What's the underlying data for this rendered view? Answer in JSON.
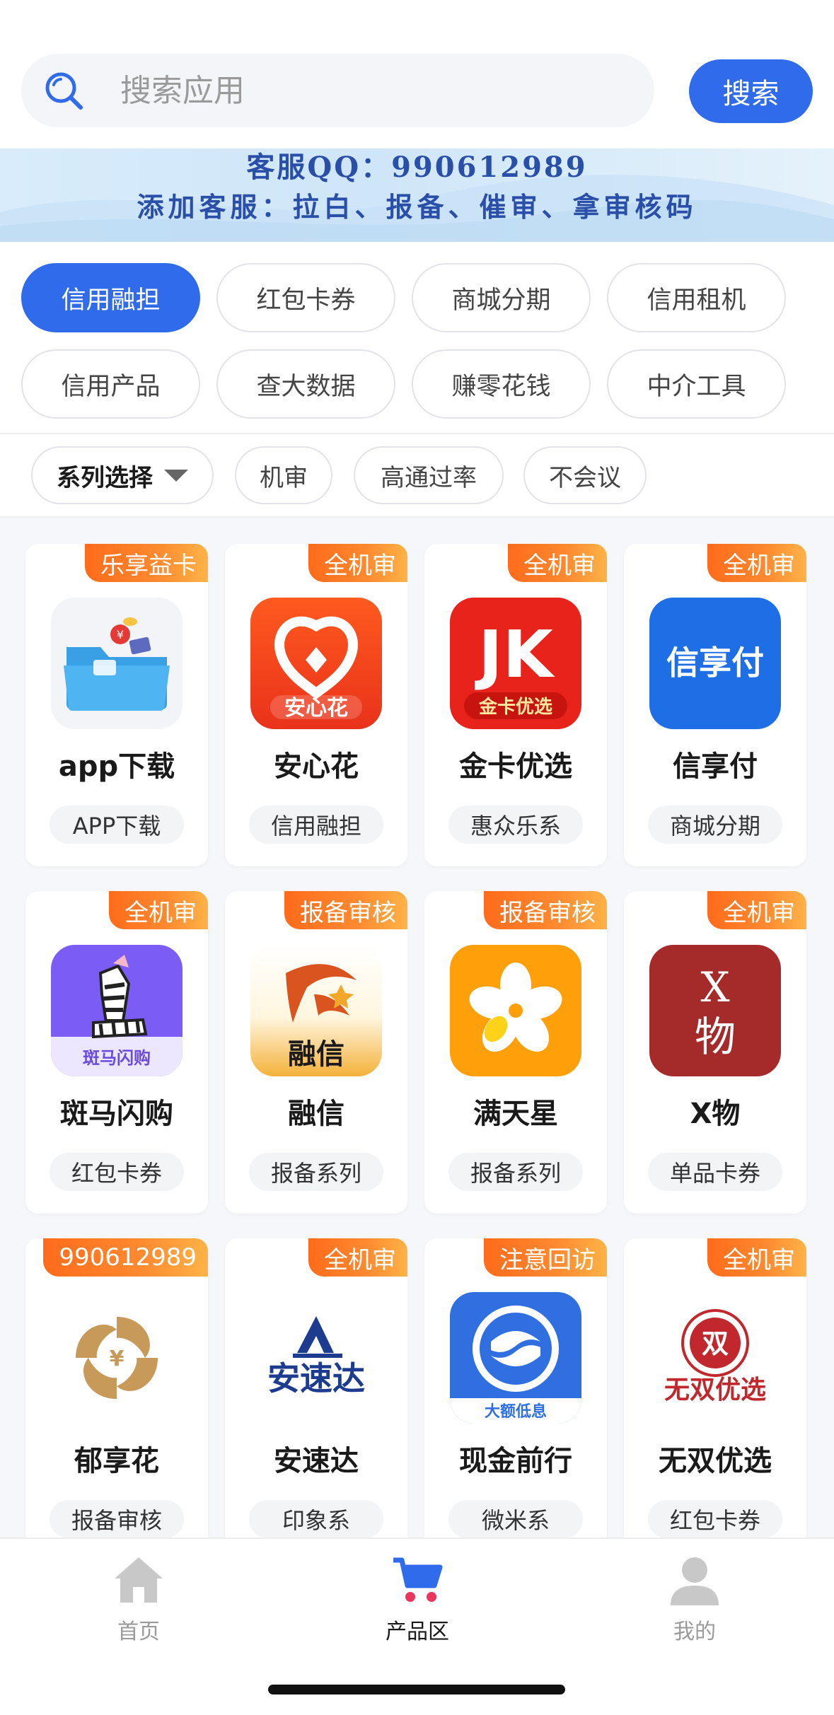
{
  "search": {
    "placeholder": "搜索应用",
    "button_label": "搜索"
  },
  "banner": {
    "line1": "客服QQ：990612989",
    "line2": "添加客服：拉白、报备、催审、拿审核码"
  },
  "categories": [
    {
      "label": "信用融担",
      "active": true
    },
    {
      "label": "红包卡券",
      "active": false
    },
    {
      "label": "商城分期",
      "active": false
    },
    {
      "label": "信用租机",
      "active": false
    },
    {
      "label": "信用产品",
      "active": false
    },
    {
      "label": "查大数据",
      "active": false
    },
    {
      "label": "赚零花钱",
      "active": false
    },
    {
      "label": "中介工具",
      "active": false
    }
  ],
  "filters": {
    "series_label": "系列选择",
    "options": [
      "机审",
      "高通过率",
      "不会议"
    ]
  },
  "apps": [
    {
      "name": "app下载",
      "tag": "乐享益卡",
      "series": "APP下载",
      "icon": "folder-icon"
    },
    {
      "name": "安心花",
      "tag": "全机审",
      "series": "信用融担",
      "icon": "anxinhua-icon",
      "icon_text": "安心花"
    },
    {
      "name": "金卡优选",
      "tag": "全机审",
      "series": "惠众乐系",
      "icon": "jk-icon",
      "icon_text": "JK",
      "icon_sub": "金卡优选"
    },
    {
      "name": "信享付",
      "tag": "全机审",
      "series": "商城分期",
      "icon": "xinxiangfu-icon",
      "icon_text": "信享付"
    },
    {
      "name": "斑马闪购",
      "tag": "全机审",
      "series": "红包卡券",
      "icon": "zebra-icon",
      "icon_text": "斑马闪购"
    },
    {
      "name": "融信",
      "tag": "报备审核",
      "series": "报备系列",
      "icon": "rongxin-icon",
      "icon_text": "融信"
    },
    {
      "name": "满天星",
      "tag": "报备审核",
      "series": "报备系列",
      "icon": "flower-icon"
    },
    {
      "name": "X物",
      "tag": "全机审",
      "series": "单品卡券",
      "icon": "xwu-icon",
      "icon_text": "X",
      "icon_sub": "物"
    },
    {
      "name": "郁享花",
      "tag": "990612989",
      "series": "报备审核",
      "icon": "swirl-yuan-icon",
      "icon_text": "¥"
    },
    {
      "name": "安速达",
      "tag": "全机审",
      "series": "印象系",
      "icon": "ansuda-icon",
      "icon_text": "安速达"
    },
    {
      "name": "现金前行",
      "tag": "注意回访",
      "series": "微米系",
      "icon": "xianjin-icon",
      "icon_text": "大额低息"
    },
    {
      "name": "无双优选",
      "tag": "全机审",
      "series": "红包卡券",
      "icon": "wushuang-icon",
      "icon_text": "无双优选",
      "icon_sub": "双"
    }
  ],
  "nav": [
    {
      "label": "首页",
      "icon": "home-icon",
      "active": false
    },
    {
      "label": "产品区",
      "icon": "cart-icon",
      "active": true
    },
    {
      "label": "我的",
      "icon": "user-icon",
      "active": false
    }
  ],
  "colors": {
    "primary": "#2f6bea",
    "tag_orange": "#ff7a22",
    "banner_text": "#2a4fa8"
  }
}
